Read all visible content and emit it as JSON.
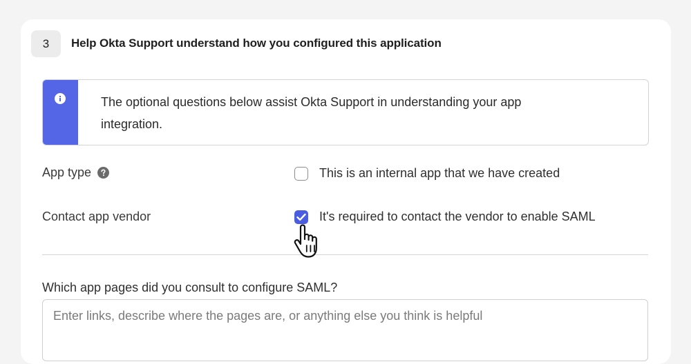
{
  "step": {
    "number": "3",
    "title": "Help Okta Support understand how you configured this application"
  },
  "callout": {
    "icon": "info-icon",
    "text": "The optional questions below assist Okta Support in understanding your app integration.",
    "accent_color": "#5465e6"
  },
  "fields": {
    "app_type": {
      "label": "App type",
      "help_icon": "question-circle-icon",
      "checkbox_label": "This is an internal app that we have created",
      "checked": false
    },
    "contact_vendor": {
      "label": "Contact app vendor",
      "checkbox_label": "It's required to contact the vendor to enable SAML",
      "checked": true,
      "check_color": "#4a5de0"
    }
  },
  "question": {
    "label": "Which app pages did you consult to configure SAML?",
    "value": "",
    "placeholder": "Enter links, describe where the pages are, or anything else you think is helpful"
  },
  "cursor": {
    "icon": "hand-pointer-icon"
  }
}
